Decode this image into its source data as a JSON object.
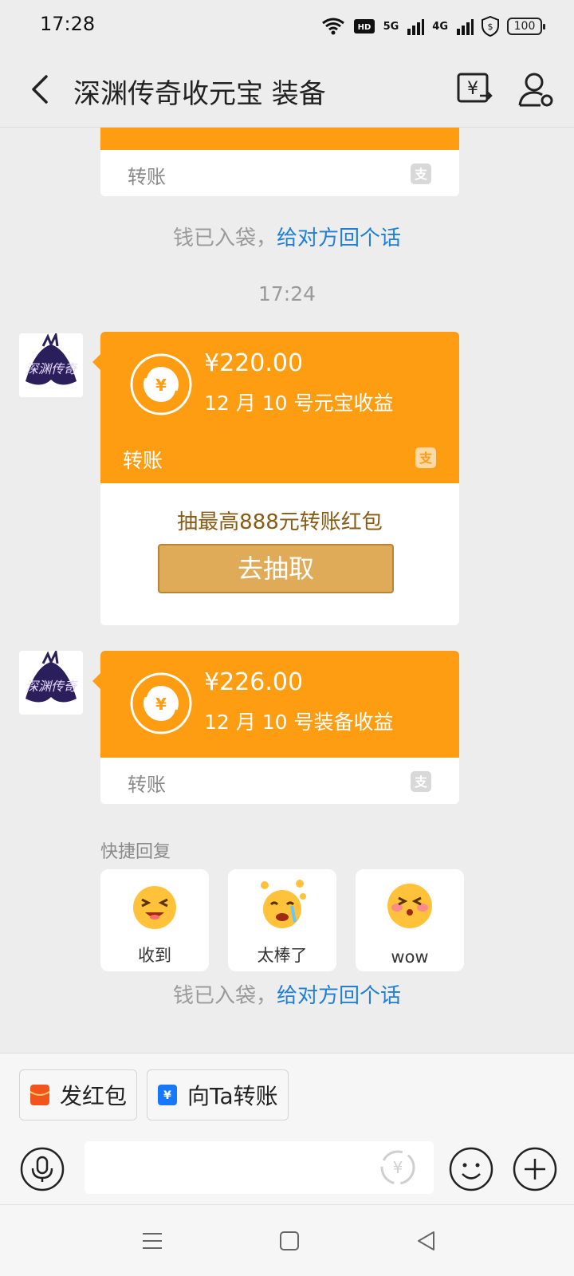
{
  "status_bar": {
    "time": "17:28",
    "network_a": "5G",
    "network_b": "4G",
    "battery": "100"
  },
  "header": {
    "title": "深渊传奇收元宝 装备"
  },
  "chat": {
    "first_card_bottom_label": "转账",
    "sys_msg_1": {
      "text": "钱已入袋，",
      "link": "给对方回个话"
    },
    "timestamp": "17:24",
    "card_1": {
      "amount": "¥220.00",
      "memo": "12 月 10 号元宝收益",
      "label": "转账",
      "promo_text": "抽最高888元转账红包",
      "promo_button": "去抽取"
    },
    "card_2": {
      "amount": "¥226.00",
      "memo": "12 月 10 号装备收益",
      "label": "转账"
    },
    "quick_reply": {
      "title": "快捷回复",
      "items": [
        {
          "label": "收到",
          "icon": "emoji-tongue-icon"
        },
        {
          "label": "太棒了",
          "icon": "emoji-crying-coins-icon"
        },
        {
          "label": "wow",
          "icon": "emoji-blush-icon"
        }
      ]
    },
    "sys_msg_2": {
      "text": "钱已入袋，",
      "link": "给对方回个话"
    }
  },
  "bottom": {
    "send_red_packet": "发红包",
    "transfer_to_ta": "向Ta转账"
  },
  "colors": {
    "accent_orange": "#fe9c12",
    "link_blue": "#1f7fd9",
    "promo_button": "#dfab58"
  }
}
